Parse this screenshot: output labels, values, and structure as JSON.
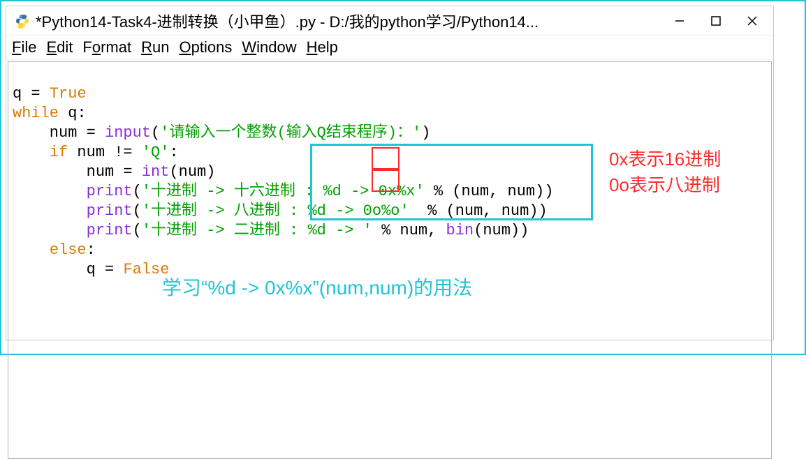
{
  "titlebar": {
    "title": "*Python14-Task4-进制转换（小甲鱼）.py - D:/我的python学习/Python14..."
  },
  "menu": {
    "file": "File",
    "edit": "Edit",
    "format": "Format",
    "run": "Run",
    "options": "Options",
    "window": "Window",
    "help": "Help"
  },
  "code": {
    "l1_q": "q = ",
    "l1_true": "True",
    "l2_while": "while",
    "l2_rest": " q:",
    "l3_pre": "    num = ",
    "l3_input": "input",
    "l3_str": "'请输入一个整数(输入Q结束程序)：'",
    "l3_close": ")",
    "l4_pre": "    ",
    "l4_if": "if",
    "l4_mid": " num != ",
    "l4_q": "'Q'",
    "l4_colon": ":",
    "l5_pre": "        num = ",
    "l5_int": "int",
    "l5_arg": "(num)",
    "l6_pre": "        ",
    "l6_print": "print",
    "l6_open": "(",
    "l6_str": "'十进制 -> 十六进制 : %d -> 0x%x'",
    "l6_rest": " % (num, num))",
    "l7_pre": "        ",
    "l7_print": "print",
    "l7_open": "(",
    "l7_str": "'十进制 -> 八进制 : %d -> 0o%o'",
    "l7_rest": "  % (num, num))",
    "l8_pre": "        ",
    "l8_print": "print",
    "l8_open": "(",
    "l8_str": "'十进制 -> 二进制 : %d -> '",
    "l8_mid": " % num, ",
    "l8_bin": "bin",
    "l8_rest": "(num))",
    "l9_pre": "    ",
    "l9_else": "else",
    "l9_colon": ":",
    "l10_pre": "        q = ",
    "l10_false": "False"
  },
  "annotations": {
    "red1": "0x表示16进制",
    "red2": "0o表示八进制",
    "cyan": "学习“%d -> 0x%x”(num,num)的用法"
  }
}
